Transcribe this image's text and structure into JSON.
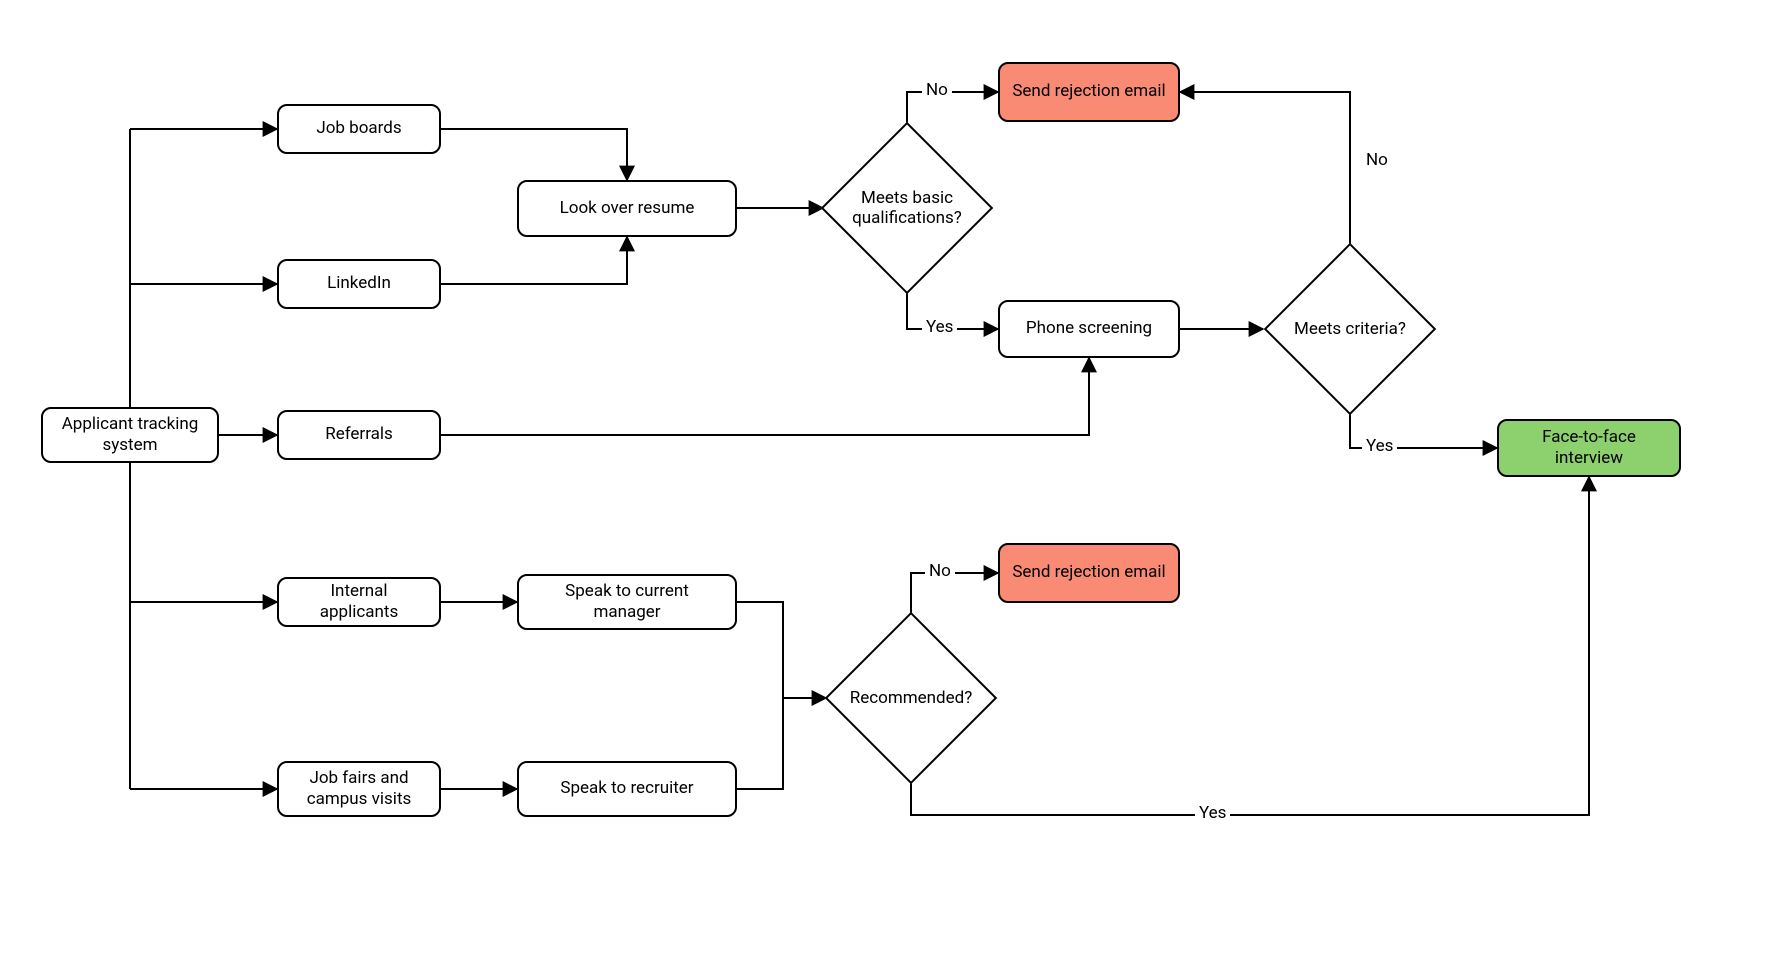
{
  "nodes": {
    "ats": "Applicant tracking system",
    "job_boards": "Job boards",
    "linkedin": "LinkedIn",
    "referrals": "Referrals",
    "internal": "Internal applicants",
    "job_fairs": "Job fairs and campus visits",
    "look_resume": "Look over resume",
    "speak_manager": "Speak to current manager",
    "speak_recruiter": "Speak to recruiter",
    "phone_screen": "Phone screening",
    "reject1": "Send rejection email",
    "reject2": "Send rejection email",
    "f2f": "Face-to-face interview"
  },
  "decisions": {
    "meets_basic": "Meets basic qualifications?",
    "meets_criteria": "Meets criteria?",
    "recommended": "Recommended?"
  },
  "edge_labels": {
    "no": "No",
    "yes": "Yes"
  },
  "colors": {
    "reject": "#f98b75",
    "success": "#8cd16e",
    "stroke": "#000000"
  }
}
